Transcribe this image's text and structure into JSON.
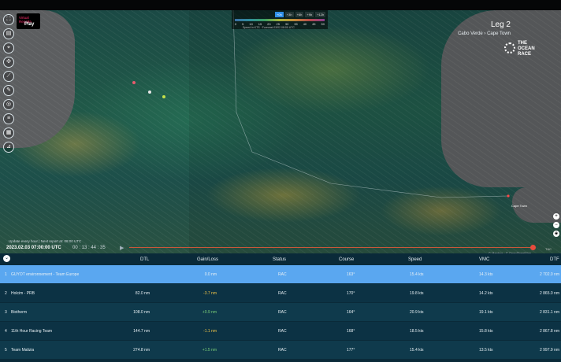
{
  "app": {
    "brand_line1": "Virtual Regatta",
    "brand_line2": "Play"
  },
  "sidebar": {
    "buttons": [
      {
        "name": "zoom-fit-button",
        "icon": "expand-icon",
        "glyph": "⛶"
      },
      {
        "name": "layers-button",
        "icon": "layers-icon",
        "glyph": "▤"
      },
      {
        "name": "center-button",
        "icon": "crosshair-icon",
        "glyph": "⌖"
      },
      {
        "name": "wind-button",
        "icon": "wind-icon",
        "glyph": "✣"
      },
      {
        "name": "ruler-button",
        "icon": "ruler-icon",
        "glyph": "⟋"
      },
      {
        "name": "routing-button",
        "icon": "route-icon",
        "glyph": "✎"
      },
      {
        "name": "camera-button",
        "icon": "camera-icon",
        "glyph": "◎"
      },
      {
        "name": "ranking-button",
        "icon": "list-icon",
        "glyph": "≡"
      },
      {
        "name": "settings-button",
        "icon": "grid-icon",
        "glyph": "▦"
      },
      {
        "name": "stats-button",
        "icon": "chart-icon",
        "glyph": "⊿"
      }
    ]
  },
  "legend": {
    "chips": [
      "+0h",
      "+3h",
      "+6h",
      "+9h",
      "+12h"
    ],
    "active_chip": "+0h",
    "ticks": [
      "0",
      "5",
      "10",
      "15",
      "20",
      "25",
      "30",
      "35",
      "40",
      "45",
      "50"
    ],
    "note": "Speed in KTS · Forecast 03/02 08:00 UTC"
  },
  "leg": {
    "title": "Leg 2",
    "subtitle": "Cabo Verde › Cape Town"
  },
  "race_logo": {
    "line1": "THE",
    "line2": "OCEAN",
    "line3": "RACE"
  },
  "map": {
    "destination_label": "Cape Town",
    "credit": "© Mapbox · © OpenStreetMap"
  },
  "zoom": {
    "plus": "+",
    "minus": "−",
    "compass": "◈"
  },
  "timeline": {
    "update_note": "Update every hour | Next report at: 08:00 UTC",
    "date": "2023.02.03 07:00:00 UTC",
    "countdown": "00 : 13 : 44 : 35",
    "tnc": "T&C"
  },
  "table": {
    "headers": {
      "dtl": "DTL",
      "gain": "Gain/Loss",
      "status": "Status",
      "course": "Course",
      "speed": "Speed",
      "vmc": "VMC",
      "dtf": "DTF"
    },
    "rows": [
      {
        "rank": "1",
        "team": "GUYOT environnement - Team Europe",
        "dtl": "",
        "gain": "0.0 nm",
        "status": "RAC",
        "course": "163°",
        "speed": "15.4 kts",
        "vmc": "14.3 kts",
        "dtf": "2 702.0 nm"
      },
      {
        "rank": "2",
        "team": "Holcim - PRB",
        "dtl": "82.0 nm",
        "gain": "-3.7 nm",
        "status": "RAC",
        "course": "170°",
        "speed": "19.8 kts",
        "vmc": "14.2 kts",
        "dtf": "2 865.0 nm"
      },
      {
        "rank": "3",
        "team": "Biotherm",
        "dtl": "108.0 nm",
        "gain": "+0.9 nm",
        "status": "RAC",
        "course": "164°",
        "speed": "20.9 kts",
        "vmc": "19.1 kts",
        "dtf": "2 831.1 nm"
      },
      {
        "rank": "4",
        "team": "11th Hour Racing Team",
        "dtl": "144.7 nm",
        "gain": "-1.1 nm",
        "status": "RAC",
        "course": "168°",
        "speed": "18.5 kts",
        "vmc": "15.8 kts",
        "dtf": "2 867.8 nm"
      },
      {
        "rank": "5",
        "team": "Team Malizia",
        "dtl": "274.8 nm",
        "gain": "+1.5 nm",
        "status": "RAC",
        "course": "177°",
        "speed": "15.4 kts",
        "vmc": "13.5 kts",
        "dtf": "2 997.9 nm"
      }
    ]
  }
}
